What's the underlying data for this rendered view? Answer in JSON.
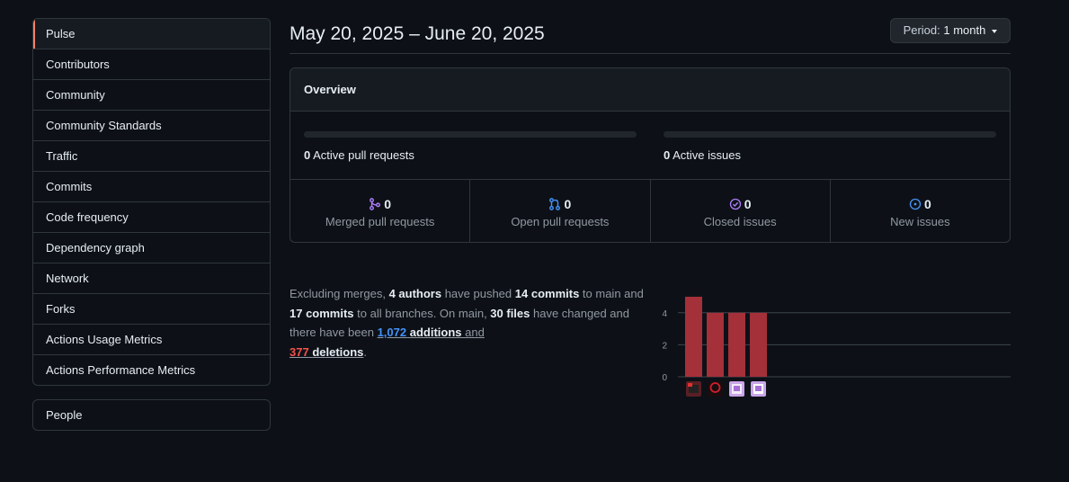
{
  "sidebar": {
    "items": [
      {
        "label": "Pulse",
        "selected": true
      },
      {
        "label": "Contributors"
      },
      {
        "label": "Community"
      },
      {
        "label": "Community Standards"
      },
      {
        "label": "Traffic"
      },
      {
        "label": "Commits"
      },
      {
        "label": "Code frequency"
      },
      {
        "label": "Dependency graph"
      },
      {
        "label": "Network"
      },
      {
        "label": "Forks"
      },
      {
        "label": "Actions Usage Metrics"
      },
      {
        "label": "Actions Performance Metrics"
      }
    ],
    "people_label": "People"
  },
  "header": {
    "date_range": "May 20, 2025 – June 20, 2025",
    "period_prefix": "Period:",
    "period_value": "1 month"
  },
  "overview": {
    "title": "Overview",
    "active_prs_count": "0",
    "active_prs_label": "Active pull requests",
    "active_issues_count": "0",
    "active_issues_label": "Active issues",
    "stats": [
      {
        "count": "0",
        "label": "Merged pull requests",
        "icon": "git-merge-icon",
        "color": "#ab7df8"
      },
      {
        "count": "0",
        "label": "Open pull requests",
        "icon": "git-pull-request-icon",
        "color": "#4493f8"
      },
      {
        "count": "0",
        "label": "Closed issues",
        "icon": "issue-closed-icon",
        "color": "#ab7df8"
      },
      {
        "count": "0",
        "label": "New issues",
        "icon": "issue-opened-icon",
        "color": "#4493f8"
      }
    ]
  },
  "summary": {
    "t1": "Excluding merges, ",
    "authors": "4 authors",
    "t2": " have pushed ",
    "commits_main": "14 commits",
    "t3": " to main and ",
    "commits_all": "17 commits",
    "t4": " to all branches. On main, ",
    "files": "30 files",
    "t5": " have changed and there have been ",
    "additions_num": "1,072",
    "additions_word": "additions",
    "t6": " and",
    "deletions_num": "377",
    "deletions_word": "deletions",
    "t7": "."
  },
  "chart_data": {
    "type": "bar",
    "categories": [
      "author-1",
      "author-2",
      "author-3",
      "author-4"
    ],
    "values": [
      5,
      4,
      4,
      4
    ],
    "ylim": [
      0,
      5
    ],
    "yticks": [
      0,
      2,
      4
    ],
    "bar_color": "#a4303a",
    "grid": true
  }
}
